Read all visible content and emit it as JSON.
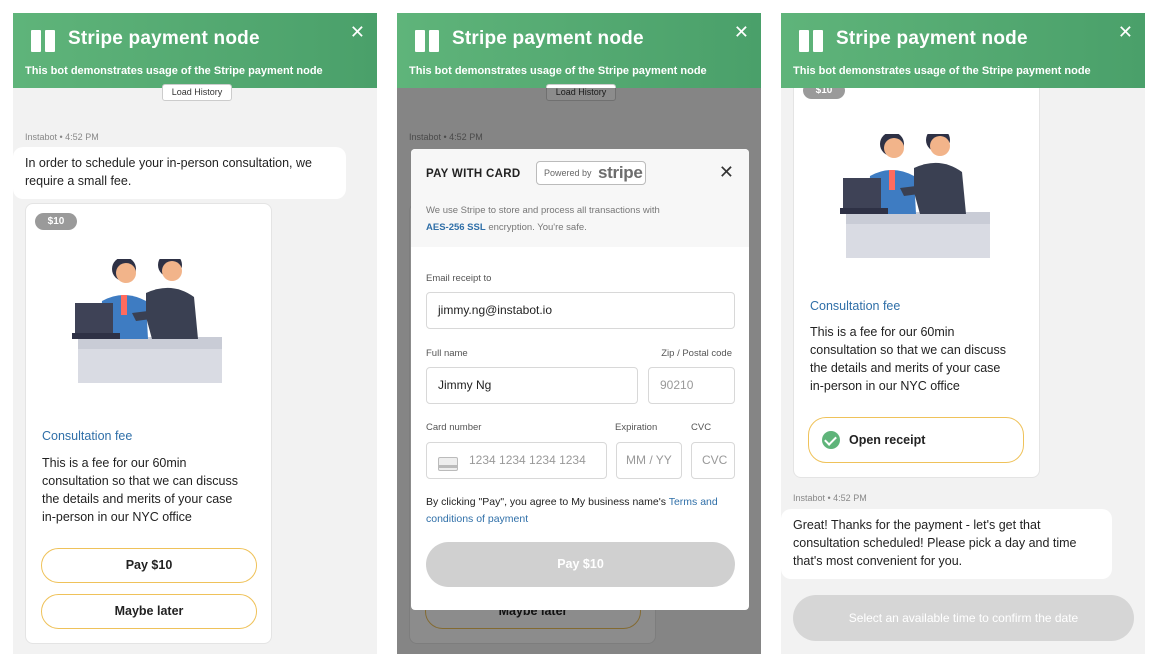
{
  "header": {
    "title": "Stripe payment node",
    "subtitle": "This bot demonstrates usage of the Stripe payment node",
    "close_glyph": "✕"
  },
  "load_history": "Load History",
  "bot_meta": "Instabot • 4:52 PM",
  "intro_message": "In order to schedule your in-person consultation, we require a small fee.",
  "product": {
    "price": "$10",
    "title": "Consultation fee",
    "desc_lines": [
      "This is a fee for our 60min",
      "consultation so that we can discuss",
      "the details and merits of your case",
      "in-person in our NYC office"
    ]
  },
  "actions": {
    "pay": "Pay $10",
    "later": "Maybe later"
  },
  "stripe_modal": {
    "heading": "PAY WITH CARD",
    "powered_by": "Powered by",
    "brand": "stripe",
    "note_before": "We use Stripe to store and process all transactions with",
    "note_highlight": "AES-256 SSL",
    "note_after": "encryption. You're safe.",
    "email_label": "Email receipt to",
    "email_value": "jimmy.ng@instabot.io",
    "fullname_label": "Full name",
    "fullname_value": "Jimmy Ng",
    "zip_label": "Zip / Postal code",
    "zip_placeholder": "90210",
    "card_label": "Card number",
    "card_placeholder": "1234 1234 1234 1234",
    "exp_label": "Expiration",
    "exp_placeholder": "MM / YY",
    "cvc_label": "CVC",
    "cvc_placeholder": "CVC",
    "terms_before": "By clicking \"Pay\", you agree to My business name's",
    "terms_link": "Terms and conditions of payment",
    "pay_button": "Pay $10"
  },
  "receipt": {
    "open_receipt": "Open receipt"
  },
  "followup_message": "Great! Thanks for the payment - let's get that consultation scheduled! Please pick a day and time that's most convenient for you.",
  "select_time": "Select an available time to confirm the date",
  "icons": {
    "logo": "instabot-logo-icon",
    "close": "close-icon",
    "check": "check-circle-icon",
    "card": "credit-card-icon",
    "illustration": "business-meeting-illustration"
  },
  "colors": {
    "header_green": "#5fb47a",
    "accent_yellow": "#efc25a",
    "link_blue": "#2f6fa8"
  }
}
